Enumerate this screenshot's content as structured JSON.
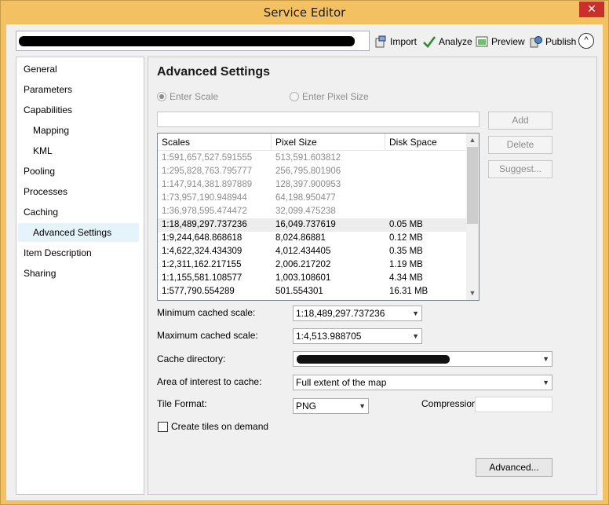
{
  "window": {
    "title": "Service Editor",
    "close_glyph": "✕"
  },
  "toolbar": {
    "import_label": "Import",
    "analyze_label": "Analyze",
    "preview_label": "Preview",
    "publish_label": "Publish",
    "collapse_glyph": "^"
  },
  "nav": {
    "items": [
      {
        "label": "General"
      },
      {
        "label": "Parameters"
      },
      {
        "label": "Capabilities"
      },
      {
        "label": "Mapping"
      },
      {
        "label": "KML"
      },
      {
        "label": "Pooling"
      },
      {
        "label": "Processes"
      },
      {
        "label": "Caching"
      },
      {
        "label": "Advanced Settings"
      },
      {
        "label": "Item Description"
      },
      {
        "label": "Sharing"
      }
    ]
  },
  "main": {
    "heading": "Advanced Settings",
    "radio_scale": "Enter Scale",
    "radio_pixel": "Enter Pixel Size",
    "add_label": "Add",
    "delete_label": "Delete",
    "suggest_label": "Suggest...",
    "table": {
      "headers": [
        "Scales",
        "Pixel Size",
        "Disk Space"
      ],
      "rows": [
        [
          "1:591,657,527.591555",
          "513,591.603812",
          ""
        ],
        [
          "1:295,828,763.795777",
          "256,795.801906",
          ""
        ],
        [
          "1:147,914,381.897889",
          "128,397.900953",
          ""
        ],
        [
          "1:73,957,190.948944",
          "64,198.950477",
          ""
        ],
        [
          "1:36,978,595.474472",
          "32,099.475238",
          ""
        ],
        [
          "1:18,489,297.737236",
          "16,049.737619",
          "0.05 MB"
        ],
        [
          "1:9,244,648.868618",
          "8,024.86881",
          "0.12 MB"
        ],
        [
          "1:4,622,324.434309",
          "4,012.434405",
          "0.35 MB"
        ],
        [
          "1:2,311,162.217155",
          "2,006.217202",
          "1.19 MB"
        ],
        [
          "1:1,155,581.108577",
          "1,003.108601",
          "4.34 MB"
        ],
        [
          "1:577,790.554289",
          "501.554301",
          "16.31 MB"
        ]
      ]
    },
    "min_scale_label": "Minimum cached scale:",
    "min_scale_value": "1:18,489,297.737236",
    "max_scale_label": "Maximum cached scale:",
    "max_scale_value": "1:4,513.988705",
    "cache_dir_label": "Cache directory:",
    "aoi_label": "Area of interest to cache:",
    "aoi_value": "Full extent of the map",
    "tile_format_label": "Tile Format:",
    "tile_format_value": "PNG",
    "compression_label": "Compression:",
    "compression_value": "",
    "create_on_demand_label": "Create tiles on demand",
    "advanced_button": "Advanced..."
  }
}
